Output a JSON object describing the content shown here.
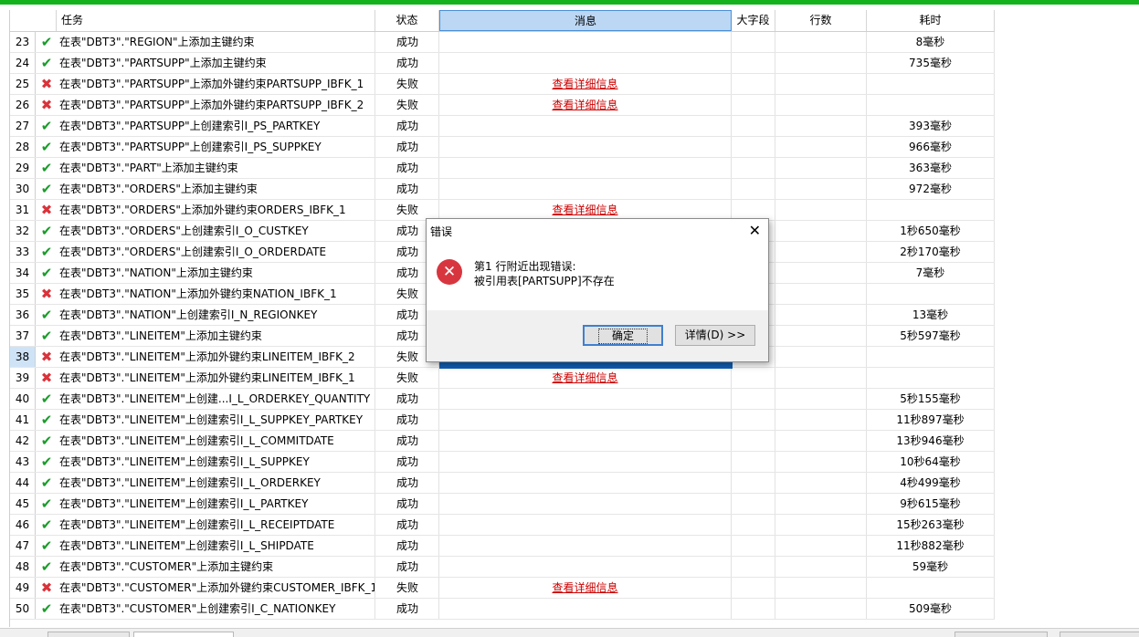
{
  "header": {
    "task": "任务",
    "status": "状态",
    "message": "消息",
    "bigfield": "大字段",
    "rows": "行数",
    "time": "耗时"
  },
  "rows": [
    {
      "n": "23",
      "ok": true,
      "task": "在表\"DBT3\".\"REGION\"上添加主键约束",
      "status": "成功",
      "msg": "",
      "time": "8毫秒"
    },
    {
      "n": "24",
      "ok": true,
      "task": "在表\"DBT3\".\"PARTSUPP\"上添加主键约束",
      "status": "成功",
      "msg": "",
      "time": "735毫秒"
    },
    {
      "n": "25",
      "ok": false,
      "task": "在表\"DBT3\".\"PARTSUPP\"上添加外键约束PARTSUPP_IBFK_1",
      "status": "失败",
      "msg": "查看详细信息",
      "time": ""
    },
    {
      "n": "26",
      "ok": false,
      "task": "在表\"DBT3\".\"PARTSUPP\"上添加外键约束PARTSUPP_IBFK_2",
      "status": "失败",
      "msg": "查看详细信息",
      "time": ""
    },
    {
      "n": "27",
      "ok": true,
      "task": "在表\"DBT3\".\"PARTSUPP\"上创建索引I_PS_PARTKEY",
      "status": "成功",
      "msg": "",
      "time": "393毫秒"
    },
    {
      "n": "28",
      "ok": true,
      "task": "在表\"DBT3\".\"PARTSUPP\"上创建索引I_PS_SUPPKEY",
      "status": "成功",
      "msg": "",
      "time": "966毫秒"
    },
    {
      "n": "29",
      "ok": true,
      "task": "在表\"DBT3\".\"PART\"上添加主键约束",
      "status": "成功",
      "msg": "",
      "time": "363毫秒"
    },
    {
      "n": "30",
      "ok": true,
      "task": "在表\"DBT3\".\"ORDERS\"上添加主键约束",
      "status": "成功",
      "msg": "",
      "time": "972毫秒"
    },
    {
      "n": "31",
      "ok": false,
      "task": "在表\"DBT3\".\"ORDERS\"上添加外键约束ORDERS_IBFK_1",
      "status": "失败",
      "msg": "查看详细信息",
      "time": ""
    },
    {
      "n": "32",
      "ok": true,
      "task": "在表\"DBT3\".\"ORDERS\"上创建索引I_O_CUSTKEY",
      "status": "成功",
      "msg": "",
      "time": "1秒650毫秒"
    },
    {
      "n": "33",
      "ok": true,
      "task": "在表\"DBT3\".\"ORDERS\"上创建索引I_O_ORDERDATE",
      "status": "成功",
      "msg": "",
      "time": "2秒170毫秒"
    },
    {
      "n": "34",
      "ok": true,
      "task": "在表\"DBT3\".\"NATION\"上添加主键约束",
      "status": "成功",
      "msg": "",
      "time": "7毫秒"
    },
    {
      "n": "35",
      "ok": false,
      "task": "在表\"DBT3\".\"NATION\"上添加外键约束NATION_IBFK_1",
      "status": "失败",
      "msg": "",
      "time": ""
    },
    {
      "n": "36",
      "ok": true,
      "task": "在表\"DBT3\".\"NATION\"上创建索引I_N_REGIONKEY",
      "status": "成功",
      "msg": "",
      "time": "13毫秒"
    },
    {
      "n": "37",
      "ok": true,
      "task": "在表\"DBT3\".\"LINEITEM\"上添加主键约束",
      "status": "成功",
      "msg": "",
      "time": "5秒597毫秒"
    },
    {
      "n": "38",
      "ok": false,
      "task": "在表\"DBT3\".\"LINEITEM\"上添加外键约束LINEITEM_IBFK_2",
      "status": "失败",
      "msg": "",
      "time": ""
    },
    {
      "n": "39",
      "ok": false,
      "task": "在表\"DBT3\".\"LINEITEM\"上添加外键约束LINEITEM_IBFK_1",
      "status": "失败",
      "msg": "查看详细信息",
      "time": ""
    },
    {
      "n": "40",
      "ok": true,
      "task": "在表\"DBT3\".\"LINEITEM\"上创建...I_L_ORDERKEY_QUANTITY",
      "status": "成功",
      "msg": "",
      "time": "5秒155毫秒"
    },
    {
      "n": "41",
      "ok": true,
      "task": "在表\"DBT3\".\"LINEITEM\"上创建索引I_L_SUPPKEY_PARTKEY",
      "status": "成功",
      "msg": "",
      "time": "11秒897毫秒"
    },
    {
      "n": "42",
      "ok": true,
      "task": "在表\"DBT3\".\"LINEITEM\"上创建索引I_L_COMMITDATE",
      "status": "成功",
      "msg": "",
      "time": "13秒946毫秒"
    },
    {
      "n": "43",
      "ok": true,
      "task": "在表\"DBT3\".\"LINEITEM\"上创建索引I_L_SUPPKEY",
      "status": "成功",
      "msg": "",
      "time": "10秒64毫秒"
    },
    {
      "n": "44",
      "ok": true,
      "task": "在表\"DBT3\".\"LINEITEM\"上创建索引I_L_ORDERKEY",
      "status": "成功",
      "msg": "",
      "time": "4秒499毫秒"
    },
    {
      "n": "45",
      "ok": true,
      "task": "在表\"DBT3\".\"LINEITEM\"上创建索引I_L_PARTKEY",
      "status": "成功",
      "msg": "",
      "time": "9秒615毫秒"
    },
    {
      "n": "46",
      "ok": true,
      "task": "在表\"DBT3\".\"LINEITEM\"上创建索引I_L_RECEIPTDATE",
      "status": "成功",
      "msg": "",
      "time": "15秒263毫秒"
    },
    {
      "n": "47",
      "ok": true,
      "task": "在表\"DBT3\".\"LINEITEM\"上创建索引I_L_SHIPDATE",
      "status": "成功",
      "msg": "",
      "time": "11秒882毫秒"
    },
    {
      "n": "48",
      "ok": true,
      "task": "在表\"DBT3\".\"CUSTOMER\"上添加主键约束",
      "status": "成功",
      "msg": "",
      "time": "59毫秒"
    },
    {
      "n": "49",
      "ok": false,
      "task": "在表\"DBT3\".\"CUSTOMER\"上添加外键约束CUSTOMER_IBFK_1",
      "status": "失败",
      "msg": "查看详细信息",
      "time": ""
    },
    {
      "n": "50",
      "ok": true,
      "task": "在表\"DBT3\".\"CUSTOMER\"上创建索引I_C_NATIONKEY",
      "status": "成功",
      "msg": "",
      "time": "509毫秒"
    }
  ],
  "highlight_row": "38",
  "dialog": {
    "title": "错误",
    "line1": "第1 行附近出现错误:",
    "line2": "被引用表[PARTSUPP]不存在",
    "ok_label": "确定",
    "detail_label": "详情(D) >>"
  },
  "icons": {
    "ok": "check-icon",
    "fail": "cross-icon",
    "error": "error-icon"
  },
  "colors": {
    "success": "#1a9c2a",
    "fail": "#d9333b",
    "link": "#cc0000",
    "accent": "#14b31e"
  }
}
